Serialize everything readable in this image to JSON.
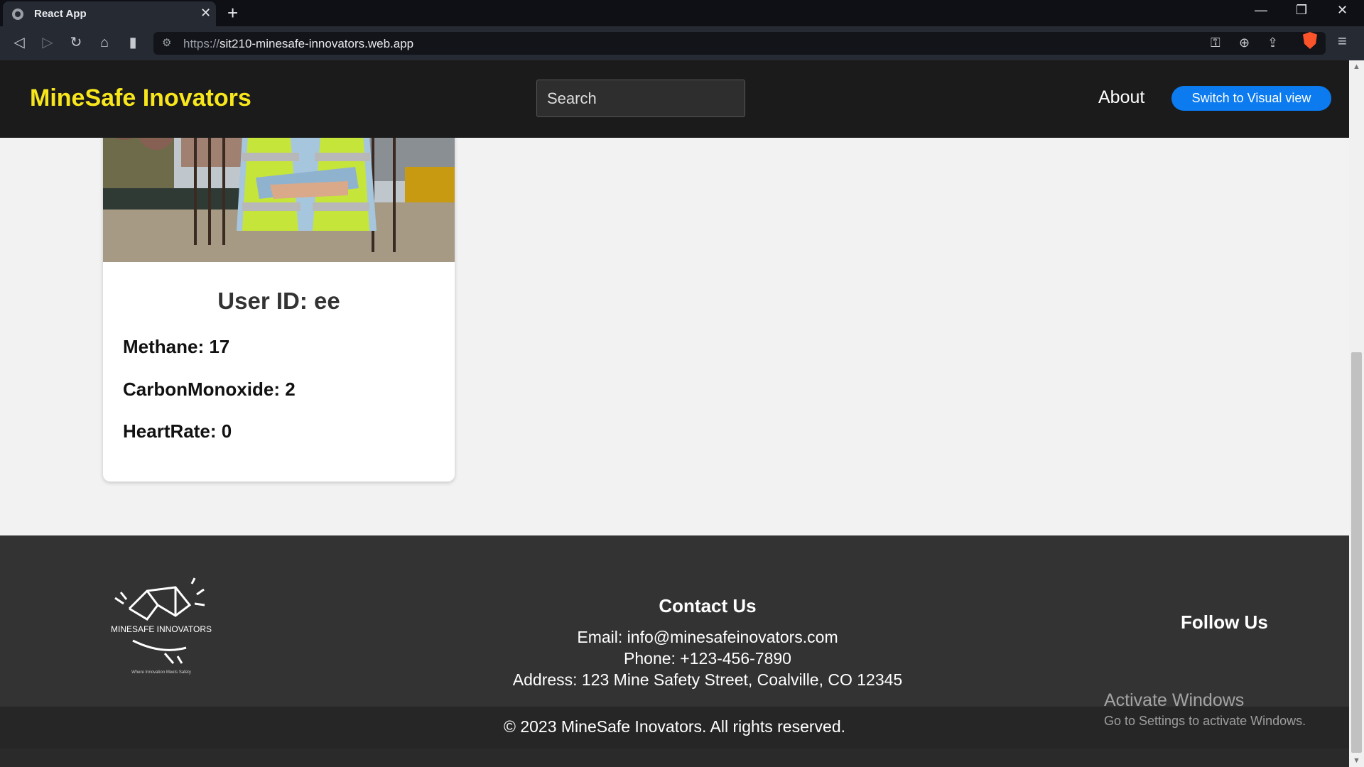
{
  "browser": {
    "tab_title": "React App",
    "tab_close": "✕",
    "new_tab": "+",
    "url_protocol": "https://",
    "url_host": "sit210-minesafe-innovators.web.app",
    "window_minimize": "—",
    "window_restore": "❐",
    "window_close": "✕"
  },
  "navbar": {
    "brand": "MineSafe Inovators",
    "search_placeholder": "Search",
    "about_label": "About",
    "switch_label": "Switch to Visual view"
  },
  "card": {
    "title": "User ID: ee",
    "metrics": [
      {
        "label": "Methane: 17"
      },
      {
        "label": "CarbonMonoxide: 2"
      },
      {
        "label": "HeartRate: 0"
      }
    ]
  },
  "footer": {
    "logo_text": "MINESAFE INNOVATORS",
    "logo_tagline": "Where Innovation Meets Safety",
    "contact_title": "Contact Us",
    "email": "Email: info@minesafeinovators.com",
    "phone": "Phone: +123-456-7890",
    "address": "Address: 123 Mine Safety Street, Coalville, CO 12345",
    "follow_title": "Follow Us",
    "copyright": "© 2023 MineSafe Inovators. All rights reserved."
  },
  "watermark": {
    "title": "Activate Windows",
    "subtitle": "Go to Settings to activate Windows."
  },
  "colors": {
    "brand_yellow": "#f7e61c",
    "button_blue": "#0b7bef",
    "navbar_bg": "#1b1b1b",
    "footer_bg": "#333333"
  }
}
